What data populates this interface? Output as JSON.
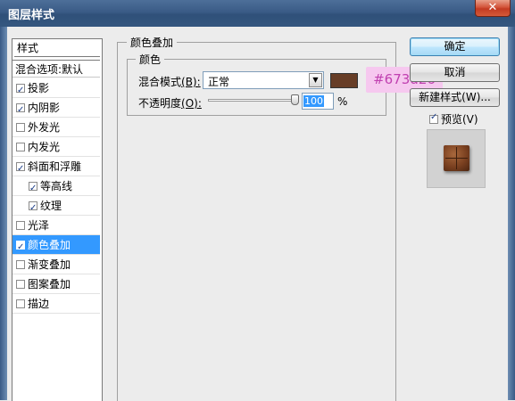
{
  "window": {
    "title": "图层样式",
    "close_glyph": "✕"
  },
  "style_list": {
    "header": "样式",
    "blend_options": "混合选项:默认",
    "items": [
      {
        "label": "投影",
        "checked": true
      },
      {
        "label": "内阴影",
        "checked": true
      },
      {
        "label": "外发光",
        "checked": false
      },
      {
        "label": "内发光",
        "checked": false
      },
      {
        "label": "斜面和浮雕",
        "checked": true
      },
      {
        "label": "等高线",
        "checked": true
      },
      {
        "label": "纹理",
        "checked": true
      },
      {
        "label": "光泽",
        "checked": false
      },
      {
        "label": "颜色叠加",
        "checked": true,
        "selected": true
      },
      {
        "label": "渐变叠加",
        "checked": false
      },
      {
        "label": "图案叠加",
        "checked": false
      },
      {
        "label": "描边",
        "checked": false
      }
    ]
  },
  "panel": {
    "group_title": "颜色叠加",
    "subgroup_title": "颜色",
    "blend_mode_label": "混合模式",
    "blend_mode_key": "(B):",
    "blend_mode_value": "正常",
    "opacity_label": "不透明度",
    "opacity_key": "(O):",
    "opacity_value": "100",
    "opacity_unit": "%",
    "opacity_fraction": 1.0,
    "overlay_color": "#673d26"
  },
  "callout_text": "#673d26",
  "buttons": {
    "ok": "确定",
    "cancel": "取消",
    "new_style": "新建样式(W)...",
    "preview": "预览(V)",
    "preview_checked": true
  },
  "colors": {
    "selection": "#3399ff",
    "callout_bg": "#f6c8ef",
    "callout_text": "#c040b0"
  }
}
